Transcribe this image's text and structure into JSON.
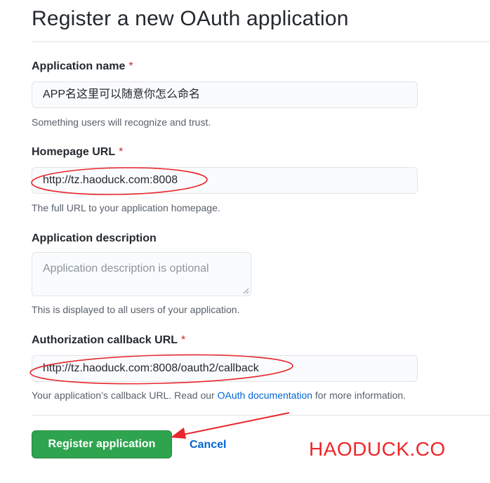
{
  "page": {
    "title": "Register a new OAuth application"
  },
  "form": {
    "app_name": {
      "label": "Application name",
      "required_mark": "*",
      "value": "APP名这里可以随意你怎么命名",
      "hint": "Something users will recognize and trust."
    },
    "homepage_url": {
      "label": "Homepage URL",
      "required_mark": "*",
      "value": "http://tz.haoduck.com:8008",
      "hint": "The full URL to your application homepage."
    },
    "description": {
      "label": "Application description",
      "placeholder": "Application description is optional",
      "hint": "This is displayed to all users of your application."
    },
    "callback_url": {
      "label": "Authorization callback URL",
      "required_mark": "*",
      "value": "http://tz.haoduck.com:8008/oauth2/callback",
      "hint_before": "Your application’s callback URL. Read our ",
      "hint_link": "OAuth documentation",
      "hint_after": " for more information."
    }
  },
  "actions": {
    "register_label": "Register application",
    "cancel_label": "Cancel"
  },
  "watermark": "HAODUCK.CO",
  "colors": {
    "primary_button": "#2ea44f",
    "link": "#0366d6",
    "required": "#cb2431",
    "annotation": "#f0262a"
  }
}
